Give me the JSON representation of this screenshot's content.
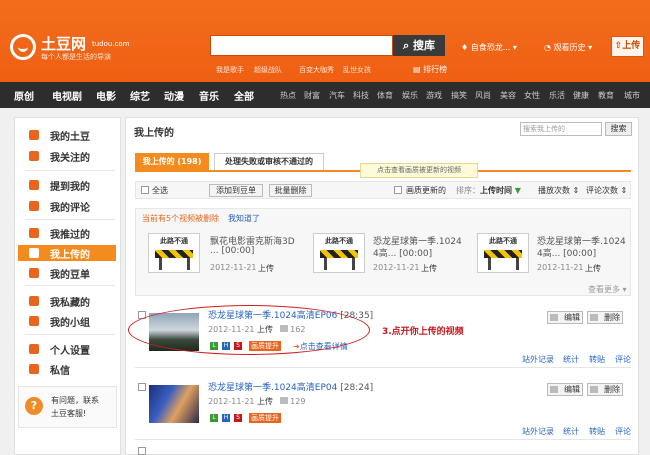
{
  "header": {
    "logo_text": "土豆网",
    "logo_domain": "tudou.com",
    "slogan": "每个人都是生活的导演",
    "search_button": "搜库",
    "hot_keywords": [
      "我是歌手",
      "超级战队",
      "百变大咖秀",
      "乱世女孩"
    ],
    "rank_link": "排行榜",
    "user_name": "自食恐龙...",
    "history": "观看历史",
    "upload": "上传"
  },
  "nav": {
    "main": [
      "原创",
      "电视剧",
      "电影",
      "综艺",
      "动漫",
      "音乐",
      "全部"
    ],
    "sub": [
      "热点",
      "财富",
      "汽车",
      "科技",
      "体育",
      "娱乐",
      "游戏",
      "搞笑",
      "风尚",
      "美容",
      "女性",
      "乐活",
      "健康",
      "教育",
      "城市"
    ]
  },
  "sidebar": {
    "items": [
      "我的土豆",
      "我关注的",
      "提到我的",
      "我的评论",
      "我推过的",
      "我上传的",
      "我的豆单",
      "我私藏的",
      "我的小组",
      "个人设置",
      "私信"
    ],
    "active": "我上传的",
    "help_line1": "有问题，联系",
    "help_line2": "土豆客服!"
  },
  "main": {
    "title": "我上传的",
    "search_placeholder": "搜索我上传的",
    "search_button": "搜索",
    "tab_uploaded": "我上传的 (198)",
    "tab_failed": "处理失败或审核不通过的",
    "tooltip": "点击查看画质被更新的视频",
    "toolbar": {
      "select_all": "全选",
      "add_playlist": "添加到豆单",
      "batch_delete": "批量删除",
      "quality_updated": "画质更新的",
      "sort": "排序：",
      "sort_time": "上传时间",
      "sort_plays": "播放次数",
      "sort_comments": "评论次数"
    },
    "deleted_notice": "当前有5个视频被删除",
    "got_it": "我知道了",
    "deleted_videos": [
      {
        "badge": "此路不通",
        "title": "飘花电影雷克斯海3D",
        "desc": "... [00:00]",
        "date": "2012-11-21",
        "status": "上传"
      },
      {
        "badge": "此路不通",
        "title": "恐龙星球第一季.1024",
        "desc": "4高... [00:00]",
        "date": "2012-11-21",
        "status": "上传"
      },
      {
        "badge": "此路不通",
        "title": "恐龙星球第一季.1024",
        "desc": "4高... [00:00]",
        "date": "2012-11-21",
        "status": "上传"
      }
    ],
    "view_more": "查看更多",
    "videos": [
      {
        "title": "恐龙星球第一季.1024高清EP06",
        "duration": "[28:35]",
        "date": "2012-11-21",
        "status": "上传",
        "plays": "162",
        "quality": "画质提升",
        "detail": "点击查看详情"
      },
      {
        "title": "恐龙星球第一季.1024高清EP04",
        "duration": "[28:24]",
        "date": "2012-11-21",
        "status": "上传",
        "plays": "129",
        "quality": "画质提升",
        "detail": ""
      }
    ],
    "edit": "编辑",
    "delete": "删除",
    "row_links": [
      "站外记录",
      "统计",
      "转贴",
      "评论"
    ],
    "annotation": "3.点开你上传的视频"
  },
  "colors": {
    "orange": "#f36d1d",
    "nav": "#2d2d2d",
    "link": "#2763c1",
    "annotation": "#c4161c"
  }
}
